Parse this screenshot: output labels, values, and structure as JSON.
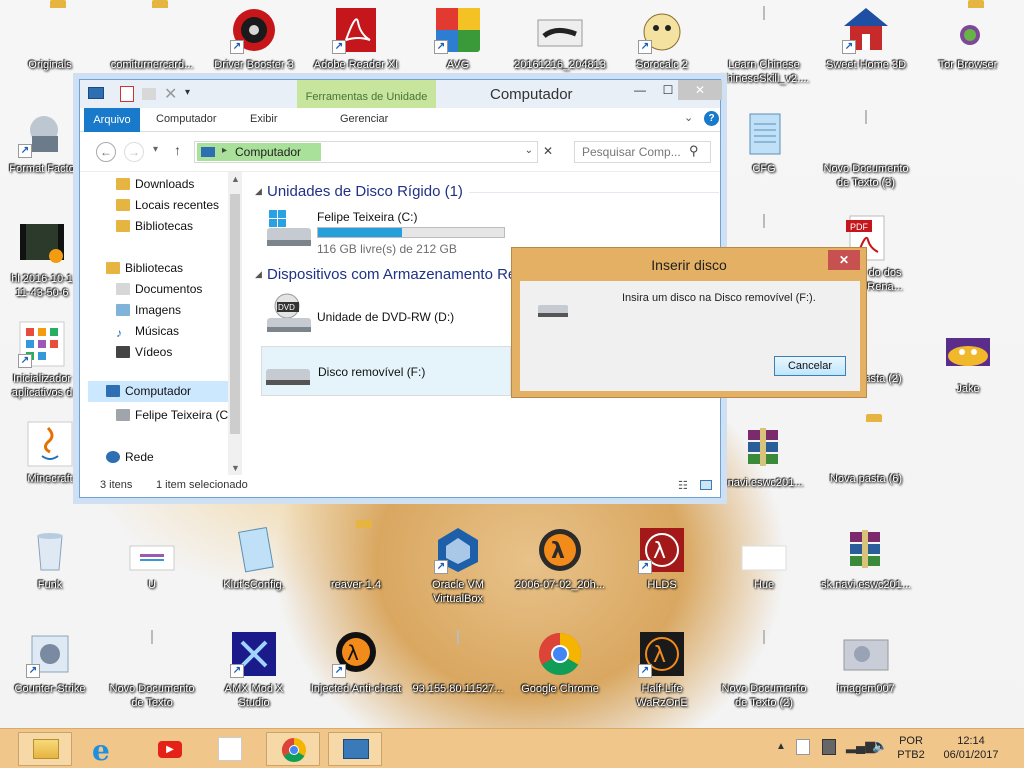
{
  "desktop": {
    "icons": [
      {
        "label": "Originals",
        "name": "originals-icon"
      },
      {
        "label": "comiturnercard...",
        "name": "document-icon"
      },
      {
        "label": "Driver Booster 3",
        "name": "driver-booster-icon"
      },
      {
        "label": "Adobe Reader XI",
        "name": "adobe-reader-icon"
      },
      {
        "label": "AVG",
        "name": "avg-icon"
      },
      {
        "label": "20161216_204813",
        "name": "photo-icon"
      },
      {
        "label": "Sorocalc 2",
        "name": "sorocalc-icon"
      },
      {
        "label": "Learn Chinese ChineseSkill_v2....",
        "name": "document-icon"
      },
      {
        "label": "Sweet Home 3D",
        "name": "sweet-home-icon"
      },
      {
        "label": "Tor Browser",
        "name": "tor-browser-icon"
      },
      {
        "label": "Format Facto",
        "name": "format-factory-icon"
      },
      {
        "label": "CFG",
        "name": "notepad-icon"
      },
      {
        "label": "Novo Documento de Texto (3)",
        "name": "text-document-icon"
      },
      {
        "label": "hl 2016-10-1 11-43-50-6",
        "name": "video-icon"
      },
      {
        "label": "do dos Rena...",
        "name": "pdf-icon"
      },
      {
        "label": "Inicializador aplicativos d",
        "name": "app-launcher-icon"
      },
      {
        "label": "pasta (2)",
        "name": "folder-icon"
      },
      {
        "label": "Jake",
        "name": "jake-icon"
      },
      {
        "label": "Minecraft",
        "name": "java-icon"
      },
      {
        "label": ".navi.eswc201...",
        "name": "winrar-icon"
      },
      {
        "label": "Nova pasta (6)",
        "name": "folder-icon"
      },
      {
        "label": "Funk",
        "name": "recycle-bin-icon"
      },
      {
        "label": "U",
        "name": "file-icon"
      },
      {
        "label": "Klut'sConfig.",
        "name": "notepad-icon"
      },
      {
        "label": "reaver-1.4",
        "name": "folder-icon"
      },
      {
        "label": "Oracle VM VirtualBox",
        "name": "virtualbox-icon"
      },
      {
        "label": "2006-07-02_20h...",
        "name": "half-life-2-icon"
      },
      {
        "label": "HLDS",
        "name": "half-life-icon"
      },
      {
        "label": "Hue",
        "name": "file-icon"
      },
      {
        "label": "sk.navi.eswc201...",
        "name": "winrar-icon"
      },
      {
        "label": "Counter-Strike",
        "name": "counter-strike-icon"
      },
      {
        "label": "Novo Documento de Texto",
        "name": "text-document-icon"
      },
      {
        "label": "AMX Mod X Studio",
        "name": "amx-studio-icon"
      },
      {
        "label": "Injected Anti-cheat",
        "name": "anticheat-icon"
      },
      {
        "label": "93.155.80.11527...",
        "name": "text-document-icon"
      },
      {
        "label": "Google Chrome",
        "name": "chrome-icon"
      },
      {
        "label": "Half-Life WaRzOnE",
        "name": "half-life-icon"
      },
      {
        "label": "Novo Documento de Texto (2)",
        "name": "text-document-icon"
      },
      {
        "label": "imagem007",
        "name": "image-icon"
      }
    ]
  },
  "explorer": {
    "title": "Computador",
    "contextual_tab": "Ferramentas de Unidade",
    "tabs": {
      "file": "Arquivo",
      "computer": "Computador",
      "view": "Exibir",
      "manage": "Gerenciar"
    },
    "address": "Computador",
    "search_placeholder": "Pesquisar Comp...",
    "nav": {
      "downloads": "Downloads",
      "recent": "Locais recentes",
      "libraries_fav": "Bibliotecas",
      "libraries": "Bibliotecas",
      "documents": "Documentos",
      "pictures": "Imagens",
      "music": "Músicas",
      "videos": "Vídeos",
      "computer": "Computador",
      "drive_c": "Felipe Teixeira (C",
      "network": "Rede"
    },
    "groups": {
      "hdd": "Unidades de Disco Rígido (1)",
      "removable": "Dispositivos com Armazenamento Re"
    },
    "drives": {
      "c_name": "Felipe Teixeira (C:)",
      "c_free": "116 GB livre(s) de 212 GB",
      "c_used_fraction": 0.45,
      "dvd": "Unidade de DVD-RW (D:)",
      "dvd_badge": "DVD",
      "removable": "Disco removível (F:)"
    },
    "status": {
      "items": "3 itens",
      "selected": "1 item selecionado"
    }
  },
  "dialog": {
    "title": "Inserir disco",
    "message": "Insira um disco na Disco removível (F:).",
    "cancel": "Cancelar"
  },
  "taskbar": {
    "lang1": "POR",
    "lang2": "PTB2",
    "time": "12:14",
    "date": "06/01/2017"
  }
}
